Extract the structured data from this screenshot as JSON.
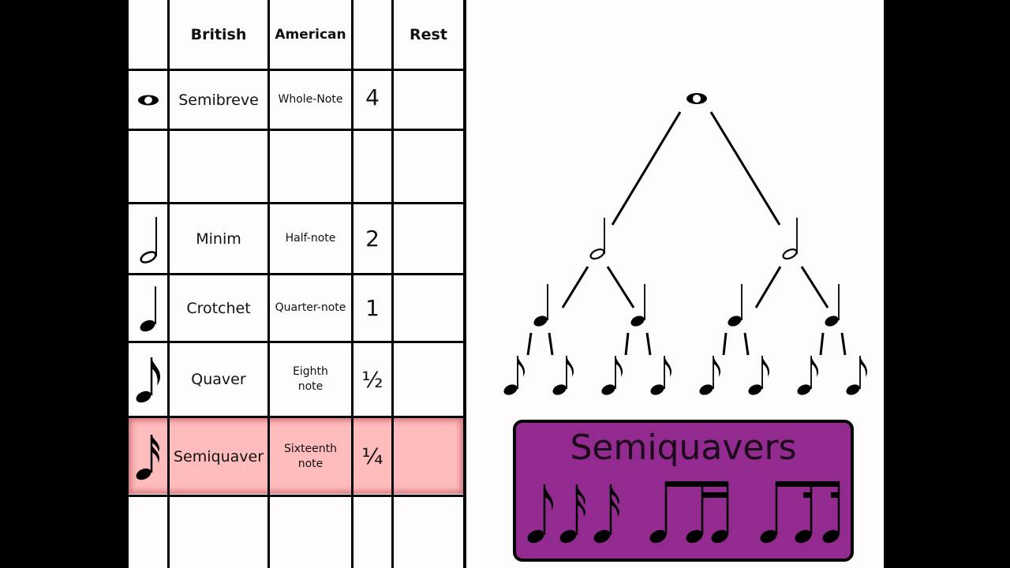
{
  "table": {
    "headers": [
      "",
      "British",
      "American",
      "",
      "Rest"
    ],
    "rows": [
      {
        "icon": "semibreve-icon",
        "british": "Semibreve",
        "american": "Whole-Note",
        "beats": "4",
        "rest": ""
      },
      {
        "icon": "",
        "british": "",
        "american": "",
        "beats": "",
        "rest": ""
      },
      {
        "icon": "minim-icon",
        "british": "Minim",
        "american": "Half-note",
        "beats": "2",
        "rest": ""
      },
      {
        "icon": "crotchet-icon",
        "british": "Crotchet",
        "american": "Quarter-note",
        "beats": "1",
        "rest": ""
      },
      {
        "icon": "quaver-icon",
        "british": "Quaver",
        "american": "Eighth note",
        "beats": "½",
        "rest": ""
      },
      {
        "icon": "semiquaver-icon",
        "british": "Semiquaver",
        "american": "Sixteenth note",
        "beats": "¼",
        "rest": "",
        "highlighted": true
      },
      {
        "icon": "",
        "british": "",
        "american": "",
        "beats": "",
        "rest": ""
      }
    ],
    "highlight_color": "#ffbcbd"
  },
  "tree": {
    "levels": [
      {
        "note": "semibreve",
        "count": 1
      },
      {
        "note": "minim",
        "count": 2
      },
      {
        "note": "crotchet",
        "count": 4
      },
      {
        "note": "quaver",
        "count": 8
      }
    ]
  },
  "callout": {
    "title": "Semiquavers",
    "background": "#922a90",
    "examples": [
      "quaver-icon",
      "semiquaver-icon",
      "semiquaver-icon",
      "quaver-two-semiquavers-beamed-icon",
      "dotted-beamed-group-icon"
    ]
  }
}
